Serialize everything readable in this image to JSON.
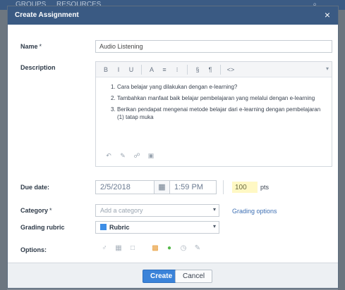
{
  "background": {
    "tabs": [
      "GROUPS",
      "RESOURCES"
    ],
    "search_icon": "search-icon"
  },
  "dialog": {
    "title": "Create Assignment",
    "close_label": "×"
  },
  "form": {
    "name_label": "Name",
    "name_required": "*",
    "name_value": "Audio Listening",
    "description_label": "Description",
    "toolbar_buttons": [
      "B",
      "I",
      "U",
      "A",
      "≡",
      "⁝",
      "§",
      "¶",
      "<>"
    ],
    "description_items": [
      "Cara belajar yang dilakukan dengan e-learning?",
      "Tambahkan manfaat baik belajar pembelajaran yang melalui dengan e-learning",
      "Berikan pendapat mengenai metode belajar dari e-learning dengan pembelajaran (1) tatap muka"
    ],
    "due_date_label": "Due date:",
    "due_date_value": "2/5/2018",
    "due_time_value": "1:59 PM",
    "points_value": "100",
    "points_unit": "pts",
    "category_label": "Category",
    "category_required": "*",
    "category_placeholder": "Add a category",
    "category_link": "Grading options",
    "rubric_label": "Grading rubric",
    "rubric_value": "Rubric",
    "options_label": "Options:"
  },
  "footer": {
    "create_label": "Create",
    "cancel_label": "Cancel"
  },
  "colors": {
    "titlebar": "#3a5a83",
    "primary_button": "#3b83d9",
    "points_highlight": "#fff8c4"
  }
}
